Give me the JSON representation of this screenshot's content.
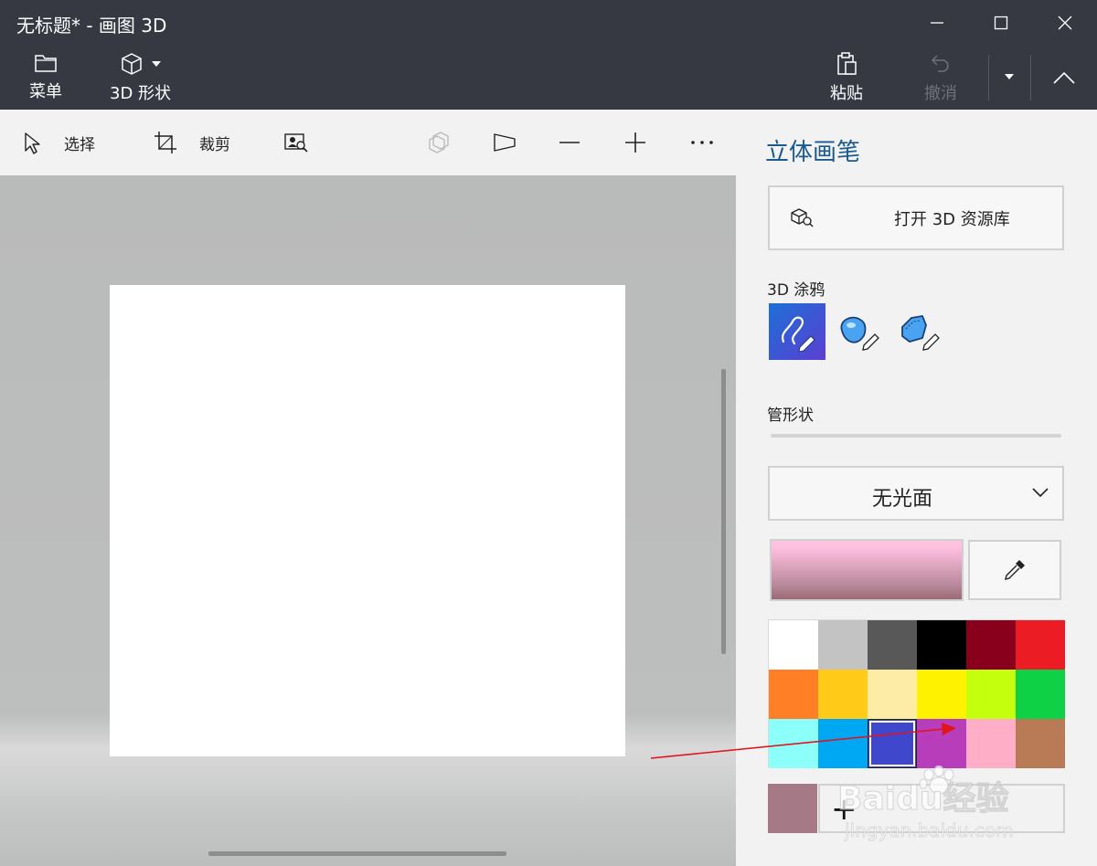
{
  "window": {
    "title": "无标题* - 画图 3D"
  },
  "ribbon": {
    "menu_label": "菜单",
    "shapes3d_label": "3D 形状",
    "paste_label": "粘贴",
    "undo_label": "撤消"
  },
  "toolbar": {
    "select_label": "选择",
    "crop_label": "裁剪"
  },
  "panel": {
    "title": "立体画笔",
    "open_library_label": "打开 3D 资源库",
    "doodle_section_label": "3D 涂鸦",
    "tube_shape_label": "管形状",
    "finish_value": "无光面",
    "current_color": "#b98a9b",
    "swatches": [
      "#ffffff",
      "#c3c3c3",
      "#585858",
      "#000000",
      "#88001b",
      "#ec1c24",
      "#ff7f27",
      "#ffca18",
      "#fdeca6",
      "#fff200",
      "#c4ff0e",
      "#0ed145",
      "#8cfffb",
      "#00a8f3",
      "#3f48cc",
      "#b83dba",
      "#ffaec8",
      "#b97a56"
    ],
    "selected_swatch_index": 14,
    "custom_color": "#a57a86"
  },
  "watermark": {
    "brand_text": "Baidu经验",
    "url_text": "jingyan.baidu.com"
  },
  "annotation_color": "#e0141c",
  "accent_color": "#1a5a92",
  "icons": {
    "menu": "folder-icon",
    "shapes3d": "cube-icon",
    "paste": "clipboard-icon",
    "undo": "undo-icon",
    "select": "cursor-icon",
    "crop": "crop-icon",
    "magic_select": "magic-select-icon",
    "view3d": "view-3d-icon",
    "perspective": "perspective-icon",
    "zoom_out": "minus-icon",
    "zoom_in": "plus-icon",
    "more": "ellipsis-icon"
  }
}
